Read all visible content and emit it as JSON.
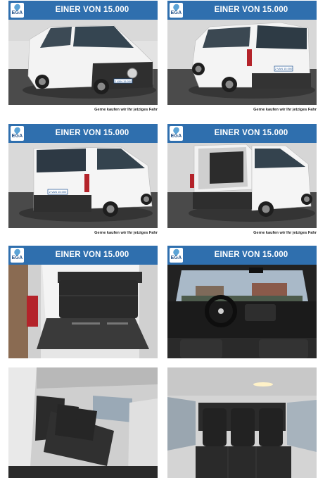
{
  "gallery": {
    "tiles": [
      {
        "banner": "EINER VON 15.000",
        "logo": "EGA",
        "footer": "Gerne kaufen wir Ihr jetziges Fahr",
        "plate": "2 VAN 15.000",
        "view": "front-three-quarter-exterior"
      },
      {
        "banner": "EINER VON 15.000",
        "logo": "EGA",
        "footer": "Gerne kaufen wir Ihr jetziges Fahr",
        "plate": "2 VAN 15.000",
        "view": "rear-three-quarter-exterior"
      },
      {
        "banner": "EINER VON 15.000",
        "logo": "EGA",
        "footer": "Gerne kaufen wir Ihr jetziges Fahr",
        "plate": "2 VAN 15.000",
        "view": "rear-left-exterior"
      },
      {
        "banner": "EINER VON 15.000",
        "logo": "EGA",
        "footer": "Gerne kaufen wir Ihr jetziges Fahr",
        "plate": "",
        "view": "rear-door-open-exterior"
      },
      {
        "banner": "EINER VON 15.000",
        "logo": "EGA",
        "footer": "",
        "plate": "",
        "view": "cargo-area-seats"
      },
      {
        "banner": "EINER VON 15.000",
        "logo": "EGA",
        "footer": "",
        "plate": "",
        "view": "cockpit-dashboard"
      },
      {
        "banner": "",
        "logo": "",
        "footer": "",
        "plate": "",
        "view": "passenger-seats-side"
      },
      {
        "banner": "",
        "logo": "",
        "footer": "",
        "plate": "",
        "view": "passenger-seats-rear"
      }
    ]
  },
  "colors": {
    "banner": "#2f6fae",
    "van_body": "#f2f2f2",
    "bumper": "#3a3a3a",
    "seat": "#2b2b2b",
    "ground": "#4a4a4a"
  }
}
